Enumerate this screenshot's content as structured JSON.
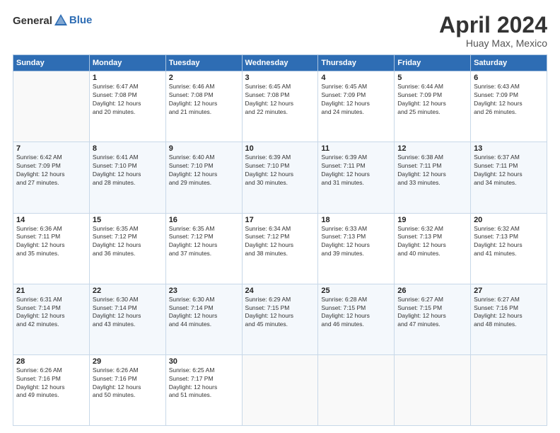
{
  "logo": {
    "general": "General",
    "blue": "Blue"
  },
  "title": "April 2024",
  "location": "Huay Max, Mexico",
  "days_header": [
    "Sunday",
    "Monday",
    "Tuesday",
    "Wednesday",
    "Thursday",
    "Friday",
    "Saturday"
  ],
  "weeks": [
    [
      {
        "day": "",
        "info": ""
      },
      {
        "day": "1",
        "info": "Sunrise: 6:47 AM\nSunset: 7:08 PM\nDaylight: 12 hours\nand 20 minutes."
      },
      {
        "day": "2",
        "info": "Sunrise: 6:46 AM\nSunset: 7:08 PM\nDaylight: 12 hours\nand 21 minutes."
      },
      {
        "day": "3",
        "info": "Sunrise: 6:45 AM\nSunset: 7:08 PM\nDaylight: 12 hours\nand 22 minutes."
      },
      {
        "day": "4",
        "info": "Sunrise: 6:45 AM\nSunset: 7:09 PM\nDaylight: 12 hours\nand 24 minutes."
      },
      {
        "day": "5",
        "info": "Sunrise: 6:44 AM\nSunset: 7:09 PM\nDaylight: 12 hours\nand 25 minutes."
      },
      {
        "day": "6",
        "info": "Sunrise: 6:43 AM\nSunset: 7:09 PM\nDaylight: 12 hours\nand 26 minutes."
      }
    ],
    [
      {
        "day": "7",
        "info": "Sunrise: 6:42 AM\nSunset: 7:09 PM\nDaylight: 12 hours\nand 27 minutes."
      },
      {
        "day": "8",
        "info": "Sunrise: 6:41 AM\nSunset: 7:10 PM\nDaylight: 12 hours\nand 28 minutes."
      },
      {
        "day": "9",
        "info": "Sunrise: 6:40 AM\nSunset: 7:10 PM\nDaylight: 12 hours\nand 29 minutes."
      },
      {
        "day": "10",
        "info": "Sunrise: 6:39 AM\nSunset: 7:10 PM\nDaylight: 12 hours\nand 30 minutes."
      },
      {
        "day": "11",
        "info": "Sunrise: 6:39 AM\nSunset: 7:11 PM\nDaylight: 12 hours\nand 31 minutes."
      },
      {
        "day": "12",
        "info": "Sunrise: 6:38 AM\nSunset: 7:11 PM\nDaylight: 12 hours\nand 33 minutes."
      },
      {
        "day": "13",
        "info": "Sunrise: 6:37 AM\nSunset: 7:11 PM\nDaylight: 12 hours\nand 34 minutes."
      }
    ],
    [
      {
        "day": "14",
        "info": "Sunrise: 6:36 AM\nSunset: 7:11 PM\nDaylight: 12 hours\nand 35 minutes."
      },
      {
        "day": "15",
        "info": "Sunrise: 6:35 AM\nSunset: 7:12 PM\nDaylight: 12 hours\nand 36 minutes."
      },
      {
        "day": "16",
        "info": "Sunrise: 6:35 AM\nSunset: 7:12 PM\nDaylight: 12 hours\nand 37 minutes."
      },
      {
        "day": "17",
        "info": "Sunrise: 6:34 AM\nSunset: 7:12 PM\nDaylight: 12 hours\nand 38 minutes."
      },
      {
        "day": "18",
        "info": "Sunrise: 6:33 AM\nSunset: 7:13 PM\nDaylight: 12 hours\nand 39 minutes."
      },
      {
        "day": "19",
        "info": "Sunrise: 6:32 AM\nSunset: 7:13 PM\nDaylight: 12 hours\nand 40 minutes."
      },
      {
        "day": "20",
        "info": "Sunrise: 6:32 AM\nSunset: 7:13 PM\nDaylight: 12 hours\nand 41 minutes."
      }
    ],
    [
      {
        "day": "21",
        "info": "Sunrise: 6:31 AM\nSunset: 7:14 PM\nDaylight: 12 hours\nand 42 minutes."
      },
      {
        "day": "22",
        "info": "Sunrise: 6:30 AM\nSunset: 7:14 PM\nDaylight: 12 hours\nand 43 minutes."
      },
      {
        "day": "23",
        "info": "Sunrise: 6:30 AM\nSunset: 7:14 PM\nDaylight: 12 hours\nand 44 minutes."
      },
      {
        "day": "24",
        "info": "Sunrise: 6:29 AM\nSunset: 7:15 PM\nDaylight: 12 hours\nand 45 minutes."
      },
      {
        "day": "25",
        "info": "Sunrise: 6:28 AM\nSunset: 7:15 PM\nDaylight: 12 hours\nand 46 minutes."
      },
      {
        "day": "26",
        "info": "Sunrise: 6:27 AM\nSunset: 7:15 PM\nDaylight: 12 hours\nand 47 minutes."
      },
      {
        "day": "27",
        "info": "Sunrise: 6:27 AM\nSunset: 7:16 PM\nDaylight: 12 hours\nand 48 minutes."
      }
    ],
    [
      {
        "day": "28",
        "info": "Sunrise: 6:26 AM\nSunset: 7:16 PM\nDaylight: 12 hours\nand 49 minutes."
      },
      {
        "day": "29",
        "info": "Sunrise: 6:26 AM\nSunset: 7:16 PM\nDaylight: 12 hours\nand 50 minutes."
      },
      {
        "day": "30",
        "info": "Sunrise: 6:25 AM\nSunset: 7:17 PM\nDaylight: 12 hours\nand 51 minutes."
      },
      {
        "day": "",
        "info": ""
      },
      {
        "day": "",
        "info": ""
      },
      {
        "day": "",
        "info": ""
      },
      {
        "day": "",
        "info": ""
      }
    ]
  ]
}
